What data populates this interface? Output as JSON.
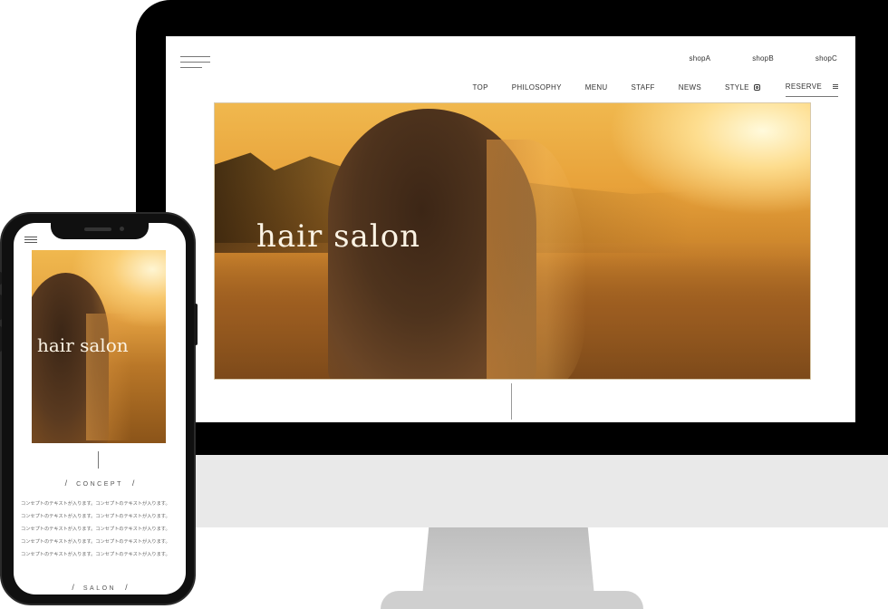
{
  "desktop": {
    "shops": [
      "shopA",
      "shopB",
      "shopC"
    ],
    "nav": [
      "TOP",
      "PHILOSOPHY",
      "MENU",
      "STAFF",
      "NEWS"
    ],
    "nav_style": "STYLE",
    "nav_reserve": "RESERVE",
    "hero_title": "hair salon",
    "icons": [
      "hamburger-icon",
      "instagram-icon",
      "list-icon"
    ]
  },
  "mobile": {
    "hero_title": "hair salon",
    "concept_heading": "CONCEPT",
    "concept_lines": [
      "コンセプトのテキストが入ります。コンセプトのテキストが入ります。",
      "コンセプトのテキストが入ります。コンセプトのテキストが入ります。",
      "コンセプトのテキストが入ります。コンセプトのテキストが入ります。",
      "コンセプトのテキストが入ります。コンセプトのテキストが入ります。",
      "コンセプトのテキストが入ります。コンセプトのテキストが入ります。"
    ],
    "salon_heading": "SALON",
    "icons": [
      "hamburger-icon"
    ]
  },
  "colors": {
    "text": "#333333",
    "hero_warm": "#e8a23a",
    "device_frame": "#000000",
    "monitor_chin": "#e9e9e9"
  }
}
